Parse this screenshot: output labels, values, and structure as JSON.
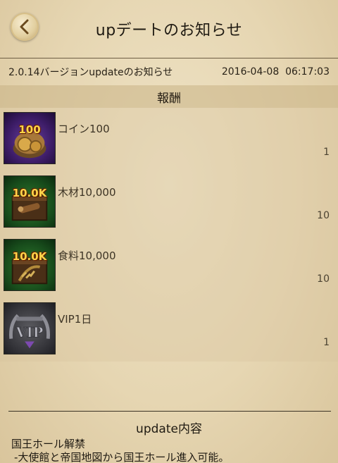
{
  "header": {
    "title": "upデートのお知らせ"
  },
  "notice": {
    "title": "2.0.14バージョンupdateのお知らせ",
    "datetime": "2016-04-08  06:17:03"
  },
  "rewards": {
    "heading": "報酬",
    "items": [
      {
        "name": "コイン100",
        "badge": "100",
        "count": "1",
        "icon": "coin-chest-icon"
      },
      {
        "name": "木材10,000",
        "badge": "10.0K",
        "count": "10",
        "icon": "wood-chest-icon"
      },
      {
        "name": "食料10,000",
        "badge": "10.0K",
        "count": "10",
        "icon": "food-chest-icon"
      },
      {
        "name": "VIP1日",
        "badge": "",
        "count": "1",
        "icon": "vip-icon"
      }
    ]
  },
  "update": {
    "heading": "update内容",
    "lines": [
      "国王ホール解禁",
      "-大使館と帝国地図から国王ホール進入可能。"
    ]
  }
}
